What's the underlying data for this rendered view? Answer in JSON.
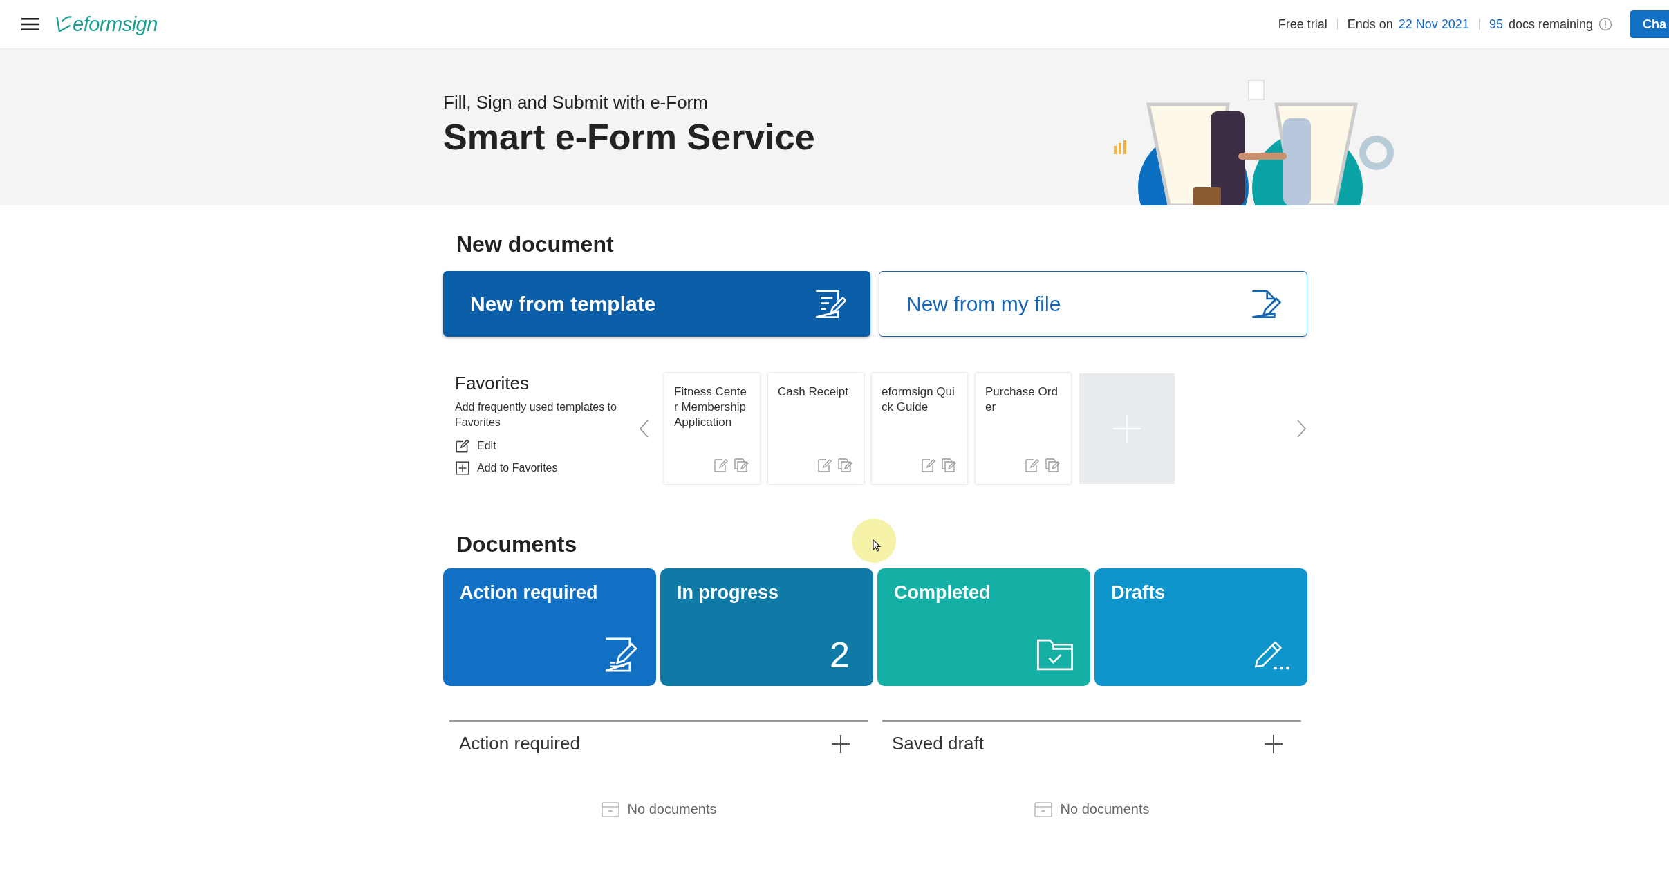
{
  "header": {
    "logo": "eformsign",
    "plan": "Free trial",
    "ends_label": "Ends on",
    "ends_date": "22 Nov 2021",
    "docs_count": "95",
    "docs_label": "docs remaining",
    "cta": "Cha"
  },
  "hero": {
    "subtitle": "Fill, Sign and Submit with e-Form",
    "title": "Smart e-Form Service"
  },
  "new_document": {
    "heading": "New document",
    "buttons": [
      {
        "label": "New from template",
        "kind": "primary"
      },
      {
        "label": "New from my file",
        "kind": "outline"
      }
    ]
  },
  "favorites": {
    "title": "Favorites",
    "description": "Add frequently used templates to Favorites",
    "actions": [
      {
        "label": "Edit",
        "kind": "edit"
      },
      {
        "label": "Add to Favorites",
        "kind": "add"
      }
    ],
    "templates": [
      {
        "name": "Fitness Center Membership Application"
      },
      {
        "name": "Cash Receipt"
      },
      {
        "name": "eformsign Quick Guide"
      },
      {
        "name": "Purchase Order"
      }
    ]
  },
  "documents": {
    "heading": "Documents",
    "tiles": [
      {
        "label": "Action required",
        "kind": "action",
        "color": "#1170c4"
      },
      {
        "label": "In progress",
        "kind": "count",
        "count": "2",
        "color": "#0f7aa6"
      },
      {
        "label": "Completed",
        "kind": "completed",
        "color": "#14b0a5"
      },
      {
        "label": "Drafts",
        "kind": "drafts",
        "color": "#0e96cc"
      }
    ]
  },
  "panels": [
    {
      "title": "Action required",
      "empty_text": "No documents"
    },
    {
      "title": "Saved draft",
      "empty_text": "No documents"
    }
  ]
}
